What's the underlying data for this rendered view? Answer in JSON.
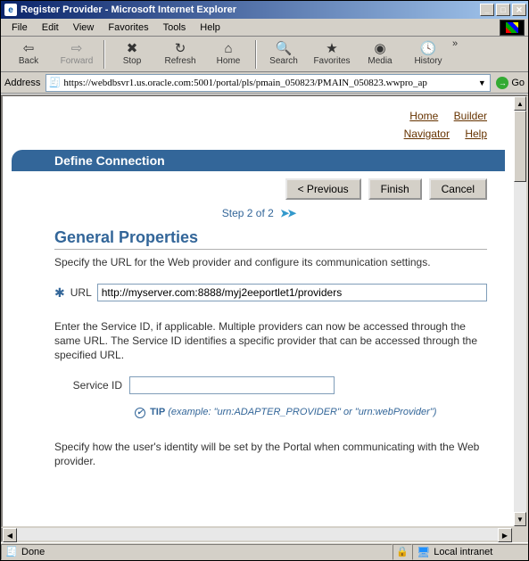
{
  "window": {
    "title": "Register Provider - Microsoft Internet Explorer"
  },
  "menu": {
    "file": "File",
    "edit": "Edit",
    "view": "View",
    "favorites": "Favorites",
    "tools": "Tools",
    "help": "Help"
  },
  "toolbar": {
    "back": "Back",
    "forward": "Forward",
    "stop": "Stop",
    "refresh": "Refresh",
    "home": "Home",
    "search": "Search",
    "favorites": "Favorites",
    "media": "Media",
    "history": "History"
  },
  "address": {
    "label": "Address",
    "value": "https://webdbsvr1.us.oracle.com:5001/portal/pls/pmain_050823/PMAIN_050823.wwpro_ap",
    "go": "Go"
  },
  "page": {
    "links": {
      "home": "Home",
      "builder": "Builder",
      "navigator": "Navigator",
      "help": "Help"
    },
    "banner": "Define Connection",
    "buttons": {
      "previous": "< Previous",
      "finish": "Finish",
      "cancel": "Cancel"
    },
    "step": "Step 2 of 2",
    "heading": "General Properties",
    "intro": "Specify the URL for the Web provider and configure its communication settings.",
    "url_label": "URL",
    "url_value": "http://myserver.com:8888/myj2eeportlet1/providers",
    "serviceid_intro": "Enter the Service ID, if applicable. Multiple providers can now be accessed through the same URL. The Service ID identifies a specific provider that can be accessed through the specified URL.",
    "serviceid_label": "Service ID",
    "serviceid_value": "",
    "tip_label": "TIP",
    "tip_text": "(example: \"urn:ADAPTER_PROVIDER\" or \"urn:webProvider\")",
    "identity_intro": "Specify how the user's identity will be set by the Portal when communicating with the Web provider."
  },
  "status": {
    "text": "Done",
    "zone": "Local intranet"
  }
}
